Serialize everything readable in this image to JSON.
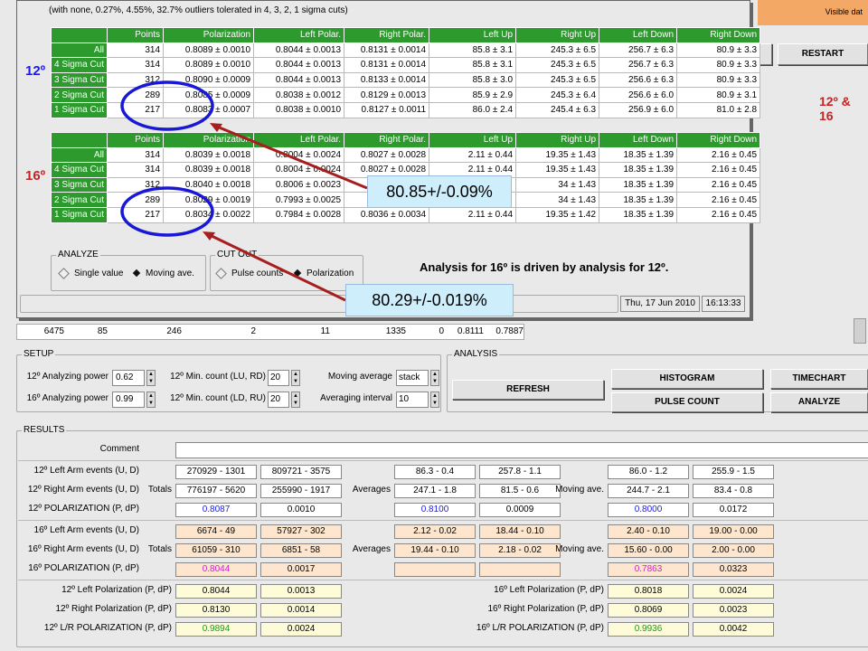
{
  "top_window": {
    "note": "(with none, 0.27%, 4.55%, 32.7% outliers tolerated in 4, 3, 2, 1 sigma cuts)",
    "visible_text": "Visible dat",
    "restart": "RESTART",
    "label_12": "12º & 16",
    "headers": [
      "Points",
      "Polarization",
      "Left Polar.",
      "Right Polar.",
      "Left Up",
      "Right Up",
      "Left Down",
      "Right Down"
    ],
    "table12": {
      "angle": "12º",
      "rows": [
        {
          "label": "All",
          "cells": [
            "314",
            "0.8089 ± 0.0010",
            "0.8044 ± 0.0013",
            "0.8131 ± 0.0014",
            "85.8 ± 3.1",
            "245.3 ± 6.5",
            "256.7 ± 6.3",
            "80.9 ± 3.3"
          ]
        },
        {
          "label": "4 Sigma Cut",
          "cells": [
            "314",
            "0.8089 ± 0.0010",
            "0.8044 ± 0.0013",
            "0.8131 ± 0.0014",
            "85.8 ± 3.1",
            "245.3 ± 6.5",
            "256.7 ± 6.3",
            "80.9 ± 3.3"
          ]
        },
        {
          "label": "3 Sigma Cut",
          "cells": [
            "312",
            "0.8090 ± 0.0009",
            "0.8044 ± 0.0013",
            "0.8133 ± 0.0014",
            "85.8 ± 3.0",
            "245.3 ± 6.5",
            "256.6 ± 6.3",
            "80.9 ± 3.3"
          ]
        },
        {
          "label": "2 Sigma Cut",
          "cells": [
            "289",
            "0.8085 ± 0.0009",
            "0.8038 ± 0.0012",
            "0.8129 ± 0.0013",
            "85.9 ± 2.9",
            "245.3 ± 6.4",
            "256.6 ± 6.0",
            "80.9 ± 3.1"
          ]
        },
        {
          "label": "1 Sigma Cut",
          "cells": [
            "217",
            "0.8083 ± 0.0007",
            "0.8038 ± 0.0010",
            "0.8127 ± 0.0011",
            "86.0 ± 2.4",
            "245.4 ± 6.3",
            "256.9 ± 6.0",
            "81.0 ± 2.8"
          ]
        }
      ]
    },
    "table16": {
      "angle": "16º",
      "rows": [
        {
          "label": "All",
          "cells": [
            "314",
            "0.8039 ± 0.0018",
            "0.8004 ± 0.0024",
            "0.8027 ± 0.0028",
            "2.11 ± 0.44",
            "19.35 ± 1.43",
            "18.35 ± 1.39",
            "2.16 ± 0.45"
          ]
        },
        {
          "label": "4 Sigma Cut",
          "cells": [
            "314",
            "0.8039 ± 0.0018",
            "0.8004 ± 0.0024",
            "0.8027 ± 0.0028",
            "2.11 ± 0.44",
            "19.35 ± 1.43",
            "18.35 ± 1.39",
            "2.16 ± 0.45"
          ]
        },
        {
          "label": "3 Sigma Cut",
          "cells": [
            "312",
            "0.8040 ± 0.0018",
            "0.8006 ± 0.0023",
            "0.8027",
            "",
            "34 ± 1.43",
            "18.35 ± 1.39",
            "2.16 ± 0.45"
          ]
        },
        {
          "label": "2 Sigma Cut",
          "cells": [
            "289",
            "0.8029 ± 0.0019",
            "0.7993 ± 0.0025",
            "0.8016",
            "",
            "34 ± 1.43",
            "18.35 ± 1.39",
            "2.16 ± 0.45"
          ]
        },
        {
          "label": "1 Sigma Cut",
          "cells": [
            "217",
            "0.8034 ± 0.0022",
            "0.7984 ± 0.0028",
            "0.8036 ± 0.0034",
            "2.11 ± 0.44",
            "19.35 ± 1.42",
            "18.35 ± 1.39",
            "2.16 ± 0.45"
          ]
        }
      ]
    },
    "analyze_group": {
      "title": "ANALYZE",
      "opt1": "Single value",
      "opt2": "Moving ave."
    },
    "cutout_group": {
      "title": "CUT OUT",
      "opt1": "Pulse counts",
      "opt2": "Polarization"
    },
    "analysis_note": "Analysis for 16º is driven by analysis for 12º.",
    "date": "Thu, 17 Jun 2010",
    "time": "16:13:33"
  },
  "callouts": {
    "top": "80.85+/-0.09%",
    "bottom": "80.29+/-0.019%"
  },
  "bg_row": [
    "6475",
    "85",
    "246",
    "2",
    "11",
    "1335",
    "0",
    "0.8111",
    "0.7887"
  ],
  "setup": {
    "title": "SETUP",
    "ap12_label": "12º Analyzing power",
    "ap12": "0.62",
    "ap16_label": "16º Analyzing power",
    "ap16": "0.99",
    "min12_label": "12º Min. count (LU, RD)",
    "min12": "20",
    "min16_label": "12º Min. count (LD, RU)",
    "min16": "20",
    "mavg_label": "Moving average",
    "mavg": "stack",
    "avgint_label": "Averaging interval",
    "avgint": "10"
  },
  "analysis": {
    "title": "ANALYSIS",
    "refresh": "REFRESH",
    "histogram": "HISTOGRAM",
    "pulse_count": "PULSE COUNT",
    "timechart": "TIMECHART",
    "analyze": "ANALYZE"
  },
  "results": {
    "title": "RESULTS",
    "comment_label": "Comment",
    "r12_left_label": "12º Left Arm events (U, D)",
    "r12_left": [
      "270929 - 1301",
      "809721 - 3575"
    ],
    "r12_left_avg": [
      "86.3 - 0.4",
      "257.8 - 1.1"
    ],
    "r12_left_mov": [
      "86.0 - 1.2",
      "255.9 - 1.5"
    ],
    "r12_right_label": "12º Right Arm events (U, D)",
    "totals": "Totals",
    "r12_right": [
      "776197 - 5620",
      "255990 - 1917"
    ],
    "averages": "Averages",
    "r12_right_avg": [
      "247.1 - 1.8",
      "81.5 - 0.6"
    ],
    "moving_ave": "Moving ave.",
    "r12_right_mov": [
      "244.7 - 2.1",
      "83.4 - 0.8"
    ],
    "r12_pol_label": "12º POLARIZATION (P, dP)",
    "r12_pol": [
      "0.8087",
      "0.0010"
    ],
    "r12_pol_avg": [
      "0.8100",
      "0.0009"
    ],
    "r12_pol_mov": [
      "0.8000",
      "0.0172"
    ],
    "r16_left_label": "16º Left Arm events (U, D)",
    "r16_left": [
      "6674 - 49",
      "57927 - 302"
    ],
    "r16_left_avg": [
      "2.12 - 0.02",
      "18.44 - 0.10"
    ],
    "r16_left_mov": [
      "2.40 - 0.10",
      "19.00 - 0.00"
    ],
    "r16_right_label": "16º Right Arm events (U, D)",
    "r16_right": [
      "61059 - 310",
      "6851 - 58"
    ],
    "r16_right_avg": [
      "19.44 - 0.10",
      "2.18 - 0.02"
    ],
    "r16_right_mov": [
      "15.60 - 0.00",
      "2.00 - 0.00"
    ],
    "r16_pol_label": "16º POLARIZATION (P, dP)",
    "r16_pol": [
      "0.8044",
      "0.0017"
    ],
    "r16_pol_mov": [
      "0.7863",
      "0.0323"
    ],
    "lp12_label": "12º Left Polarization (P, dP)",
    "lp12": [
      "0.8044",
      "0.0013"
    ],
    "rp12_label": "12º Right Polarization (P, dP)",
    "rp12": [
      "0.8130",
      "0.0014"
    ],
    "lr12_label": "12º L/R POLARIZATION (P, dP)",
    "lr12": [
      "0.9894",
      "0.0024"
    ],
    "lp16_label": "16º Left Polarization (P, dP)",
    "lp16": [
      "0.8018",
      "0.0024"
    ],
    "rp16_label": "16º Right Polarization (P, dP)",
    "rp16": [
      "0.8069",
      "0.0023"
    ],
    "lr16_label": "16º L/R POLARIZATION (P, dP)",
    "lr16": [
      "0.9936",
      "0.0042"
    ]
  },
  "colors": {
    "green": "#2d9a2d",
    "blue_text": "#1a1aee",
    "magenta_text": "#cc22cc",
    "green_text": "#1a9a1a",
    "annotation_red": "#a61e1e",
    "annotation_blue": "#1818d6",
    "callout_bg": "#cfeefb"
  }
}
